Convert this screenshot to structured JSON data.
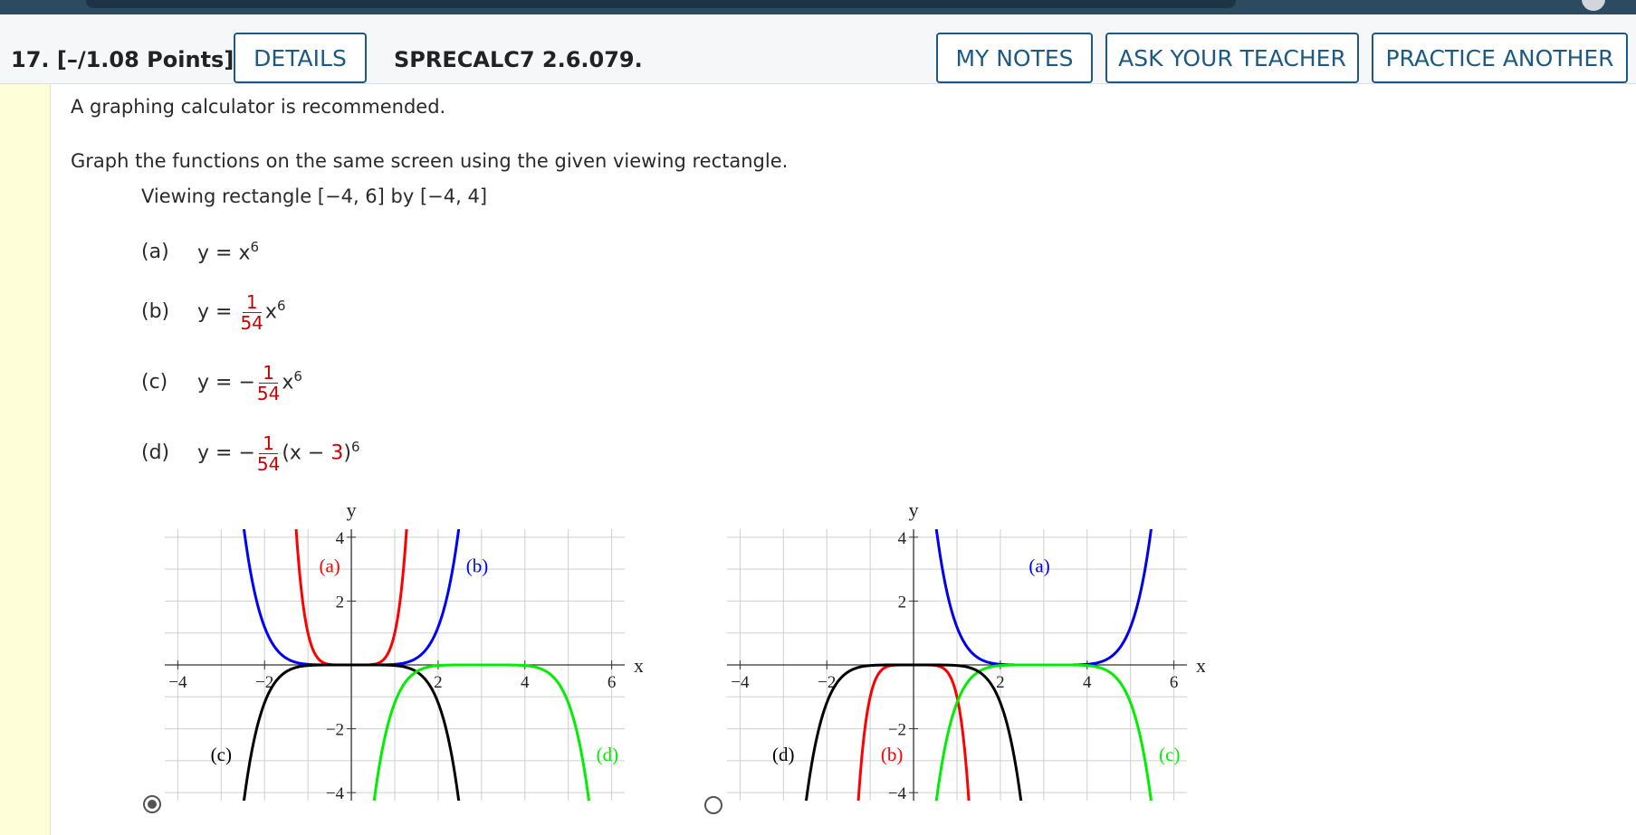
{
  "header": {
    "question_number": "17.",
    "points": "[–/1.08 Points]",
    "details_label": "DETAILS",
    "question_code": "SPRECALC7 2.6.079.",
    "my_notes_label": "MY NOTES",
    "ask_teacher_label": "ASK YOUR TEACHER",
    "practice_another_label": "PRACTICE ANOTHER"
  },
  "question": {
    "note": "A graphing calculator is recommended.",
    "instruction": "Graph the functions on the same screen using the given viewing rectangle.",
    "viewing_rectangle": "Viewing rectangle [−4, 6] by [−4, 4]",
    "parts": [
      {
        "label": "(a)",
        "prefix": "y = x",
        "exponent": "6"
      },
      {
        "label": "(b)",
        "prefix": "y = ",
        "frac_num": "1",
        "frac_den": "54",
        "suffix": "x",
        "exponent": "6"
      },
      {
        "label": "(c)",
        "prefix": "y = −",
        "frac_num": "1",
        "frac_den": "54",
        "suffix": "x",
        "exponent": "6"
      },
      {
        "label": "(d)",
        "prefix": "y = −",
        "frac_num": "1",
        "frac_den": "54",
        "suffix_a": "(x − ",
        "shift": "3",
        "suffix_b": ")",
        "exponent": "6"
      }
    ]
  },
  "colors": {
    "a": "#ff0000",
    "b": "#0000ff",
    "c": "#000000",
    "d": "#00ee00",
    "bluegraph2": "#0000ee"
  },
  "chart_data": [
    {
      "type": "line",
      "selected": true,
      "xlim": [
        -4,
        6
      ],
      "ylim": [
        -4,
        4
      ],
      "xlabel": "x",
      "ylabel": "y",
      "xticks": [
        -4,
        -2,
        2,
        4,
        6
      ],
      "yticks": [
        -4,
        -2,
        2,
        4
      ],
      "grid": true,
      "series": [
        {
          "name": "(a)",
          "color": "#ff0000",
          "func": "a",
          "label_at": [
            -0.5,
            2.9
          ]
        },
        {
          "name": "(b)",
          "color": "#0000ff",
          "func": "b",
          "label_at": [
            2.9,
            2.9
          ]
        },
        {
          "name": "(c)",
          "color": "#000000",
          "func": "c",
          "label_at": [
            -3.0,
            -3.0
          ]
        },
        {
          "name": "(d)",
          "color": "#00ee00",
          "func": "d",
          "label_at": [
            5.9,
            -3.0
          ]
        }
      ]
    },
    {
      "type": "line",
      "selected": false,
      "xlim": [
        -4,
        6
      ],
      "ylim": [
        -4,
        4
      ],
      "xlabel": "x",
      "ylabel": "y",
      "xticks": [
        -4,
        -2,
        2,
        4,
        6
      ],
      "yticks": [
        -4,
        -2,
        2,
        4
      ],
      "grid": true,
      "series": [
        {
          "name": "(a)",
          "color": "#0000ee",
          "func": "d_neg",
          "label_at": [
            2.9,
            2.9
          ]
        },
        {
          "name": "(b)",
          "color": "#ff0000",
          "func": "a_neg",
          "label_at": [
            -0.5,
            -3.0
          ]
        },
        {
          "name": "(c)",
          "color": "#00ee00",
          "func": "d",
          "label_at": [
            5.9,
            -3.0
          ]
        },
        {
          "name": "(d)",
          "color": "#000000",
          "func": "c",
          "label_at": [
            -3.0,
            -3.0
          ]
        }
      ]
    }
  ]
}
